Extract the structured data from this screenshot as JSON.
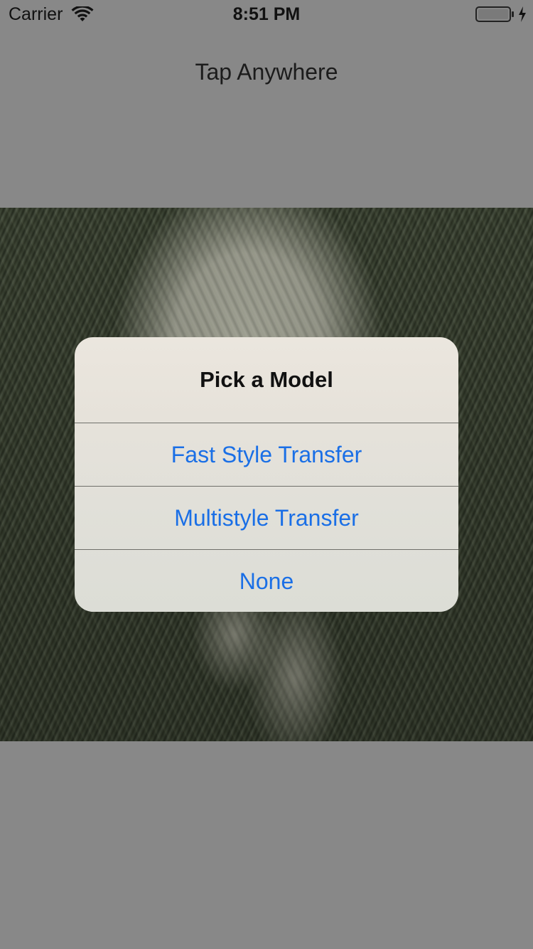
{
  "status_bar": {
    "carrier": "Carrier",
    "time": "8:51 PM",
    "icons": [
      "wifi-icon",
      "battery-icon",
      "charging-bolt-icon"
    ]
  },
  "header": {
    "label": "Tap Anywhere"
  },
  "photo": {
    "subject": "photo-image"
  },
  "alert": {
    "title": "Pick a Model",
    "actions": [
      {
        "label": "Fast Style Transfer"
      },
      {
        "label": "Multistyle Transfer"
      },
      {
        "label": "None"
      }
    ],
    "action_color": "#1a6fe6"
  },
  "colors": {
    "background": "#888888",
    "alert_background": "#e6e2da"
  }
}
